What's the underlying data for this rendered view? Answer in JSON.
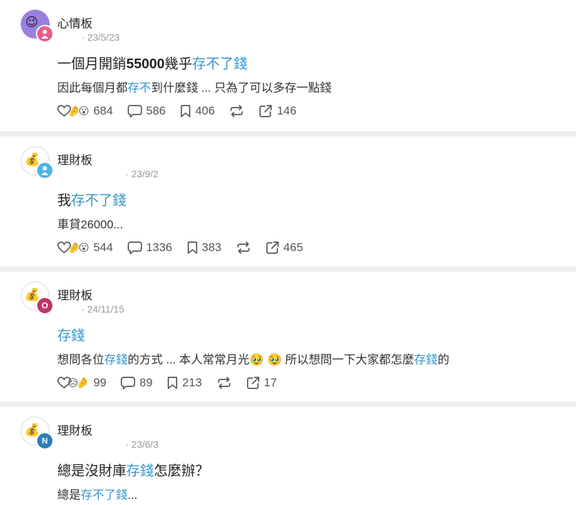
{
  "posts": [
    {
      "board": "心情板",
      "date": "· 23/5/23",
      "title_before": "一個月開銷",
      "title_bold": "55000",
      "title_mid": "幾乎",
      "title_hl": "存不了錢",
      "title_after": "",
      "excerpt_before": "因此每個月都",
      "excerpt_hl": "存不",
      "excerpt_after": "到什麼錢 ... 只為了可以多存一點錢",
      "likes": "684",
      "comments": "586",
      "saves": "406",
      "shares": "146",
      "badge_text": "",
      "badge_color": "#e65c8a"
    },
    {
      "board": "理財板",
      "date": "· 23/9/2",
      "title_before": "我",
      "title_bold": "",
      "title_mid": "",
      "title_hl": "存不了錢",
      "title_after": "",
      "excerpt_before": "車貸26000...",
      "excerpt_hl": "",
      "excerpt_after": "",
      "likes": "544",
      "comments": "1336",
      "saves": "383",
      "shares": "465",
      "badge_text": "",
      "badge_color": "#4fb3e8"
    },
    {
      "board": "理財板",
      "date": "· 24/11/15",
      "title_before": "",
      "title_bold": "",
      "title_mid": "",
      "title_hl": "存錢",
      "title_after": "",
      "excerpt_before": "想問各位",
      "excerpt_hl": "存錢",
      "excerpt_after": "的方式 ... 本人常常月光🥹 🥹 所以想問一下大家都怎麼",
      "excerpt_hl2": "存錢",
      "excerpt_after2": "的",
      "likes": "99",
      "comments": "89",
      "saves": "213",
      "shares": "17",
      "badge_text": "O",
      "badge_color": "#c0336b"
    },
    {
      "board": "理財板",
      "date": "· 23/6/3",
      "title_before": "總是沒財庫",
      "title_bold": "",
      "title_mid": "",
      "title_hl": "存錢",
      "title_after": "怎麼辦？",
      "excerpt_before": "總是",
      "excerpt_hl": "存不了錢",
      "excerpt_after": "...",
      "badge_text": "N",
      "badge_color": "#2a7db8"
    }
  ],
  "colors": {
    "highlight": "#3397cf",
    "muted": "#999999"
  },
  "icons": [
    "heart-icon",
    "comment-icon",
    "bookmark-icon",
    "repost-icon",
    "share-icon"
  ]
}
